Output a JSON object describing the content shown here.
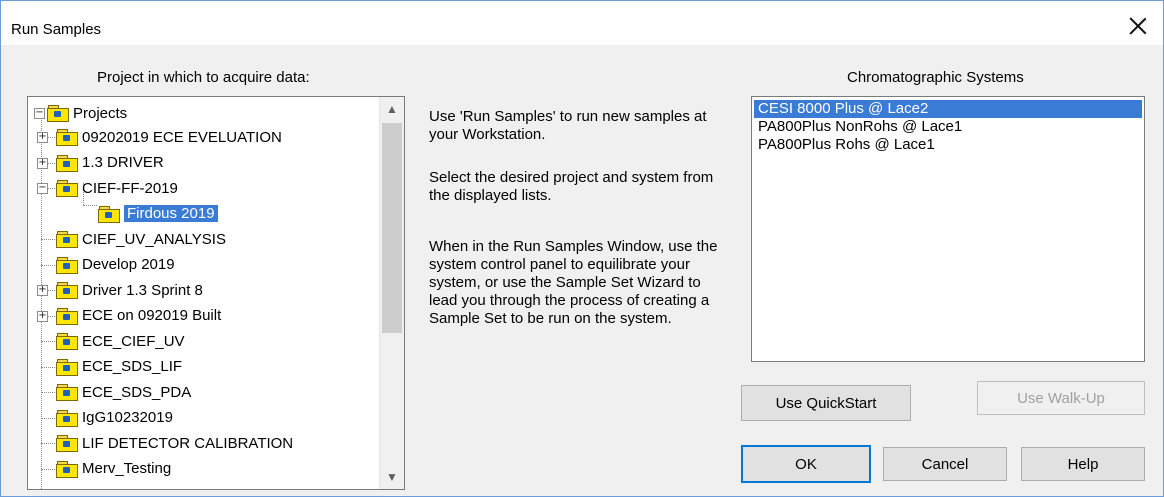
{
  "window": {
    "title": "Run Samples"
  },
  "left_label": "Project in which to acquire data:",
  "right_label": "Chromatographic Systems",
  "tree": {
    "root": "Projects",
    "items": [
      {
        "label": "09202019 ECE EVELUATION",
        "expander": "+"
      },
      {
        "label": "1.3 DRIVER",
        "expander": "+"
      },
      {
        "label": "CIEF-FF-2019",
        "expander": "-"
      },
      {
        "label": "Firdous 2019",
        "child": true,
        "selected": true
      },
      {
        "label": "CIEF_UV_ANALYSIS"
      },
      {
        "label": "Develop 2019"
      },
      {
        "label": "Driver 1.3 Sprint 8",
        "expander": "+"
      },
      {
        "label": "ECE on 092019 Built",
        "expander": "+"
      },
      {
        "label": "ECE_CIEF_UV"
      },
      {
        "label": "ECE_SDS_LIF"
      },
      {
        "label": "ECE_SDS_PDA"
      },
      {
        "label": "IgG10232019"
      },
      {
        "label": "LIF DETECTOR CALIBRATION"
      },
      {
        "label": "Merv_Testing"
      }
    ]
  },
  "help": {
    "p1": "Use 'Run Samples' to run new samples at your Workstation.",
    "p2": "Select the desired project and system from the displayed lists.",
    "p3": "When in the Run Samples Window, use the system control panel to equilibrate your system, or use the Sample Set Wizard to lead you through the process of creating a Sample Set to be run on the system."
  },
  "systems": [
    {
      "label": "CESI 8000 Plus @ Lace2",
      "selected": true
    },
    {
      "label": "PA800Plus NonRohs @ Lace1"
    },
    {
      "label": "PA800Plus Rohs @ Lace1"
    }
  ],
  "buttons": {
    "quickstart": "Use QuickStart",
    "walkup": "Use Walk-Up",
    "ok": "OK",
    "cancel": "Cancel",
    "help": "Help"
  },
  "icons": {
    "close": "close-icon",
    "folder": "project-folder-icon",
    "scroll_up": "scroll-up-arrow-icon",
    "scroll_down": "scroll-down-arrow-icon"
  }
}
